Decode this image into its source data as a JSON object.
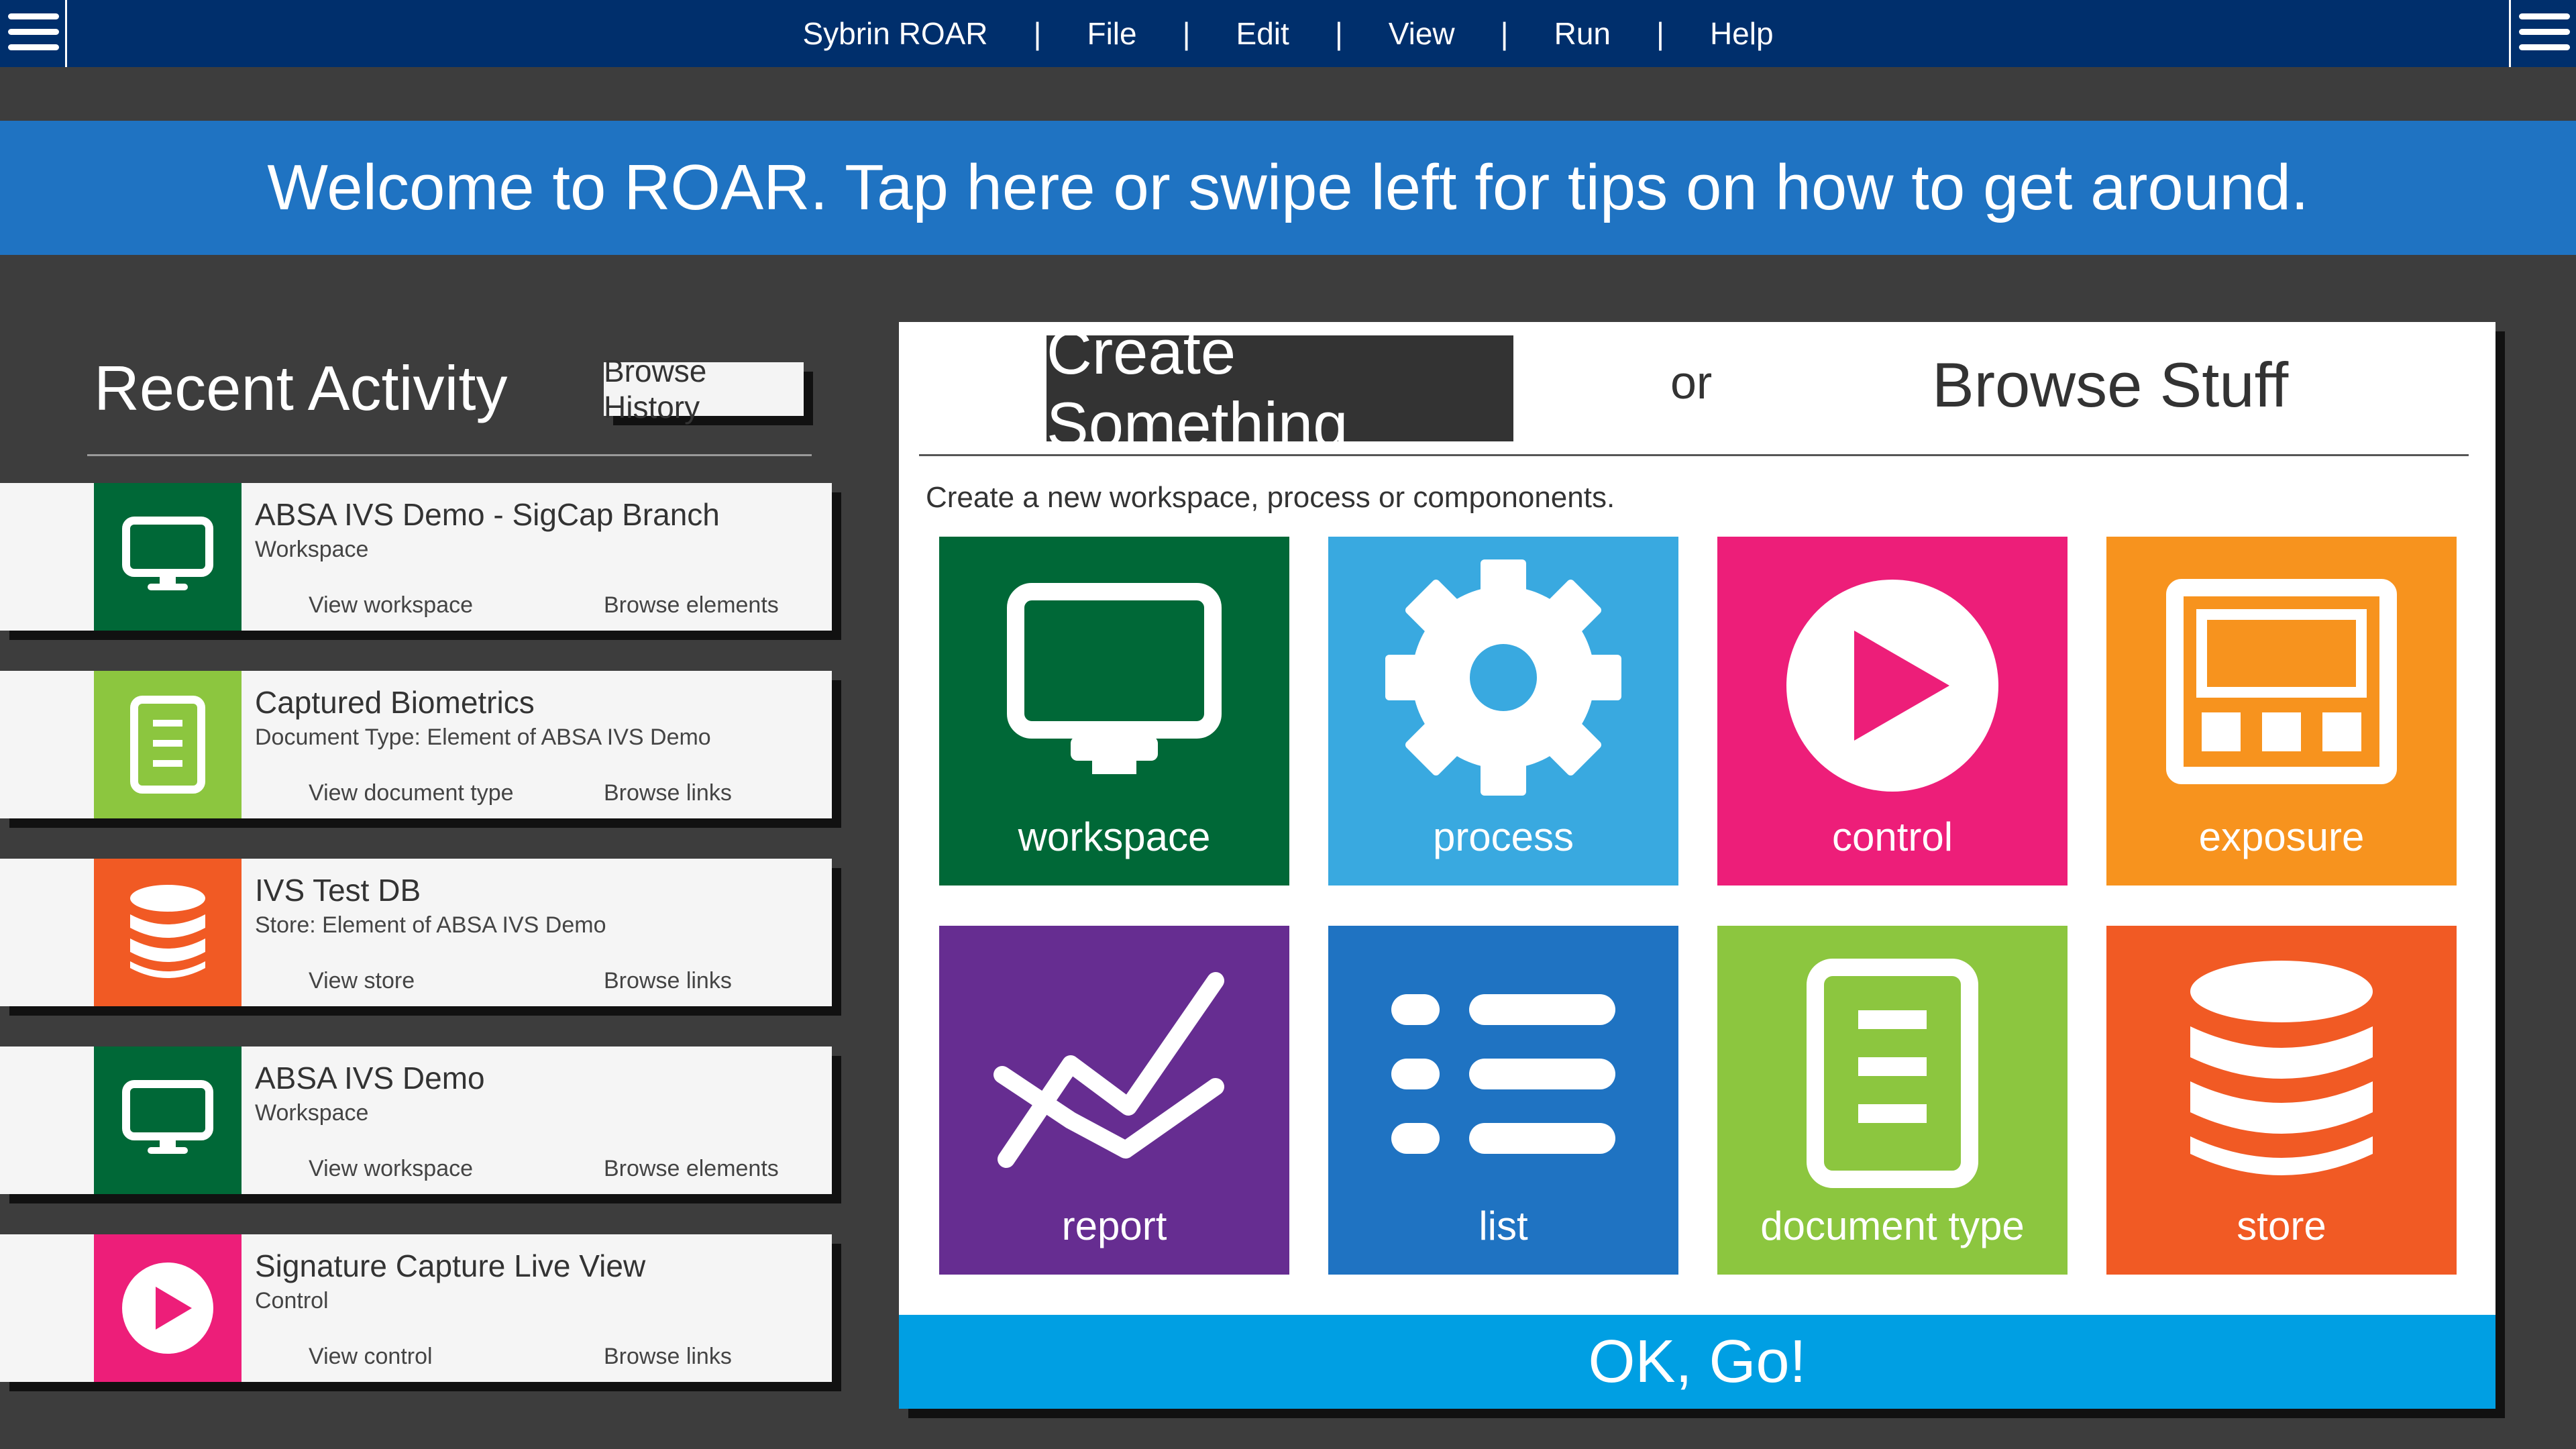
{
  "menubar": {
    "items": [
      "Sybrin ROAR",
      "File",
      "Edit",
      "View",
      "Run",
      "Help"
    ],
    "separator": "|"
  },
  "banner": {
    "text": "Welcome to ROAR. Tap here or swipe left for tips on how to get around."
  },
  "recent": {
    "title": "Recent Activity",
    "browse_history": "Browse History",
    "cards": [
      {
        "name": "ABSA IVS Demo - SigCap Branch",
        "type": "Workspace",
        "action1": "View workspace",
        "action2": "Browse elements",
        "icon": "monitor-icon",
        "color": "#006837"
      },
      {
        "name": "Captured Biometrics",
        "type": "Document Type: Element of ABSA IVS Demo",
        "action1": "View document type",
        "action2": "Browse links",
        "icon": "document-icon",
        "color": "#8cc63f"
      },
      {
        "name": "IVS Test DB",
        "type": "Store: Element of ABSA IVS Demo",
        "action1": "View store",
        "action2": "Browse links",
        "icon": "database-icon",
        "color": "#f15a24"
      },
      {
        "name": "ABSA IVS Demo",
        "type": "Workspace",
        "action1": "View workspace",
        "action2": "Browse elements",
        "icon": "monitor-icon",
        "color": "#006837"
      },
      {
        "name": "Signature Capture Live View",
        "type": "Control",
        "action1": "View control",
        "action2": "Browse links",
        "icon": "play-icon",
        "color": "#ed1e79"
      }
    ]
  },
  "panel": {
    "create_tab": "Create Something",
    "or": "or",
    "browse_tab": "Browse Stuff",
    "description": "Create a new workspace, process or compononents.",
    "tiles": [
      {
        "label": "workspace",
        "icon": "monitor-icon",
        "color": "#006837"
      },
      {
        "label": "process",
        "icon": "gear-icon",
        "color": "#39a9e0"
      },
      {
        "label": "control",
        "icon": "play-icon",
        "color": "#ed1e79"
      },
      {
        "label": "exposure",
        "icon": "layout-icon",
        "color": "#f7931e"
      },
      {
        "label": "report",
        "icon": "chart-line-icon",
        "color": "#662d91"
      },
      {
        "label": "list",
        "icon": "list-icon",
        "color": "#1f73c2"
      },
      {
        "label": "document type",
        "icon": "document-icon",
        "color": "#8cc63f"
      },
      {
        "label": "store",
        "icon": "database-icon",
        "color": "#f15a24"
      }
    ],
    "go_button": "OK, Go!"
  }
}
